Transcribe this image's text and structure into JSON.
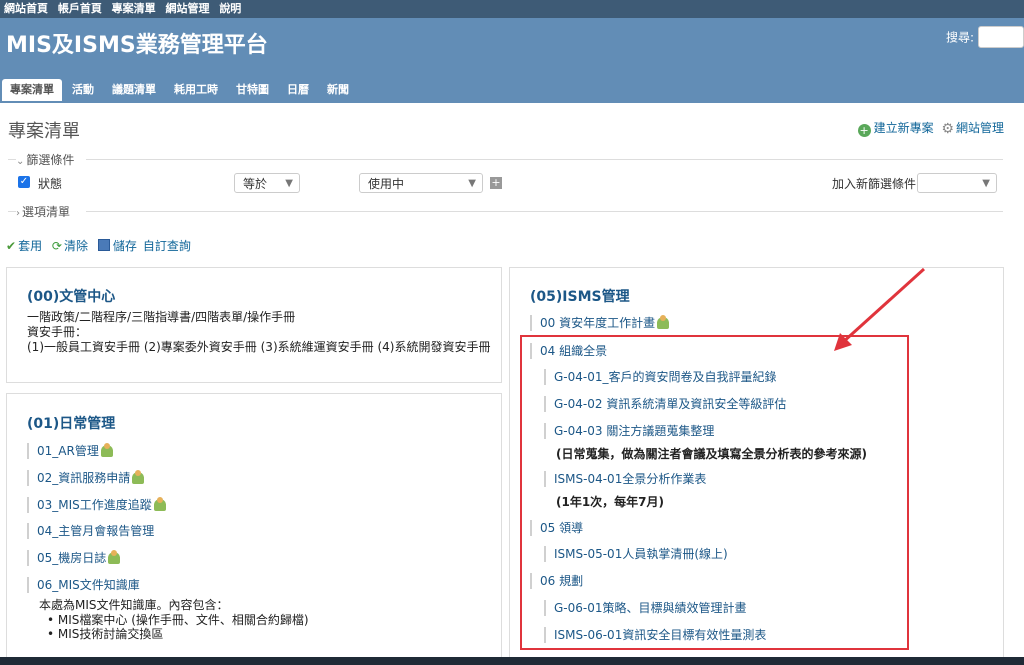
{
  "top_menu": [
    "網站首頁",
    "帳戶首頁",
    "專案清單",
    "網站管理",
    "說明"
  ],
  "header": {
    "title": "MIS及ISMS業務管理平台",
    "search_label": "搜尋:"
  },
  "main_menu": [
    "專案清單",
    "活動",
    "議題清單",
    "耗用工時",
    "甘特圖",
    "日曆",
    "新聞"
  ],
  "page": {
    "heading": "專案清單",
    "new_project": "建立新專案",
    "site_admin": "網站管理",
    "filters_legend": "篩選條件",
    "filter_status_label": "狀態",
    "filter_operator": "等於",
    "filter_value": "使用中",
    "add_filter_label": "加入新篩選條件",
    "options_legend": "選項清單",
    "apply": "套用",
    "clear": "清除",
    "save": "儲存",
    "custom_query": "自訂查詢"
  },
  "box_00": {
    "title": "(00)文管中心",
    "desc": [
      "一階政策/二階程序/三階指導書/四階表單/操作手冊",
      "資安手冊：",
      "(1)一般員工資安手冊 (2)專案委外資安手冊 (3)系統維運資安手冊 (4)系統開發資安手冊"
    ]
  },
  "box_01": {
    "title": "(01)日常管理",
    "items": [
      "01_AR管理",
      "02_資訊服務申請",
      "03_MIS工作進度追蹤",
      "04_主管月會報告管理",
      "05_機房日誌",
      "06_MIS文件知識庫"
    ],
    "kb_desc": "本處為MIS文件知識庫。內容包含：",
    "kb_bullets": [
      "MIS檔案中心 (操作手冊、文件、相關合約歸檔)",
      "MIS技術討論交換區"
    ]
  },
  "box_05": {
    "title": "(05)ISMS管理",
    "items": {
      "i00": "00 資安年度工作計畫",
      "i04": "04 組織全景",
      "i0401": "G-04-01_客戶的資安問卷及自我評量紀錄",
      "i0402": "G-04-02 資訊系統清單及資訊安全等級評估",
      "i0403": "G-04-03 關注方議題蒐集整理",
      "note1": "(日常蒐集，做為關注者會議及填寫全景分析表的參考來源)",
      "isms0401": "ISMS-04-01全景分析作業表",
      "note2": "(1年1次，每年7月)",
      "i05": "05 領導",
      "isms0501": "ISMS-05-01人員執掌清冊(線上)",
      "i06": "06 規劃",
      "g0601": "G-06-01策略、目標與績效管理計畫",
      "isms0601": "ISMS-06-01資訊安全目標有效性量測表"
    }
  },
  "colors": {
    "header": "#628db6",
    "top_menu": "#3e5b76",
    "link": "#1c5787",
    "highlight": "#e0343c"
  }
}
